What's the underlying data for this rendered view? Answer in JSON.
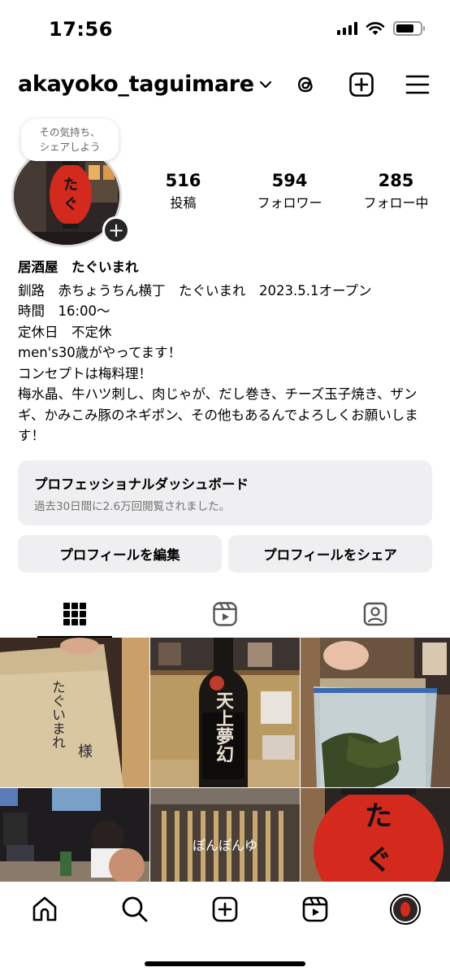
{
  "status_bar": {
    "time": "17:56"
  },
  "header": {
    "username": "akayoko_taguimare"
  },
  "profile": {
    "note": "その気持ち、\nシェアしよう",
    "stats": [
      {
        "value": "516",
        "label": "投稿"
      },
      {
        "value": "594",
        "label": "フォロワー"
      },
      {
        "value": "285",
        "label": "フォロー中"
      }
    ],
    "name": "居酒屋　たぐいまれ",
    "bio_lines": [
      "釧路　赤ちょうちん横丁　たぐいまれ　2023.5.1オープン",
      "時間　16:00〜",
      "定休日　不定休",
      "men's30歳がやってます！",
      "コンセプトは梅料理！",
      "梅水晶、牛ハツ刺し、肉じゃが、だし巻き、チーズ玉子焼き、ザンギ、かみこみ豚のネギポン、その他もあるんでよろしくお願いします！"
    ]
  },
  "dashboard": {
    "title": "プロフェッショナルダッシュボード",
    "subtitle": "過去30日間に2.6万回閲覧されました。"
  },
  "buttons": {
    "edit_profile": "プロフィールを編集",
    "share_profile": "プロフィールをシェア"
  },
  "posts": {
    "post1_text": "たぐいまれ",
    "post1_text2": "様",
    "post2_label": "天上夢幻",
    "post5_text": "ぽんぽんゆ"
  },
  "colors": {
    "lantern_red": "#d42a1e",
    "button_bg": "#efeff1",
    "muted_text": "#737373"
  }
}
